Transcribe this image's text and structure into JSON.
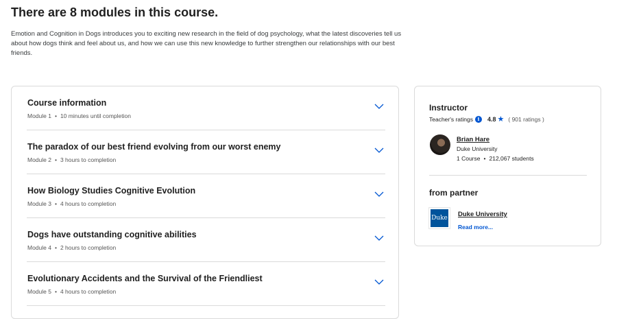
{
  "heading": "There are 8 modules in this course.",
  "description": "Emotion and Cognition in Dogs introduces you to exciting new research in the field of dog psychology, what the latest discoveries tell us about how dogs think and feel about us, and how we can use this new knowledge to further strengthen our relationships with our best friends.",
  "modules": [
    {
      "title": "Course information",
      "module": "Module 1",
      "duration": "10 minutes until completion"
    },
    {
      "title": "The paradox of our best friend evolving from our worst enemy",
      "module": "Module 2",
      "duration": "3 hours to completion"
    },
    {
      "title": "How Biology Studies Cognitive Evolution",
      "module": "Module 3",
      "duration": "4 hours to completion"
    },
    {
      "title": "Dogs have outstanding cognitive abilities",
      "module": "Module 4",
      "duration": "2 hours to completion"
    },
    {
      "title": "Evolutionary Accidents and the Survival of the Friendliest",
      "module": "Module 5",
      "duration": "4 hours to completion"
    }
  ],
  "meta_separator": "•",
  "instructor": {
    "heading": "Instructor",
    "ratings_label": "Teacher's ratings",
    "rating": "4.8",
    "rating_count": "( 901 ratings )",
    "name": "Brian Hare",
    "university": "Duke University",
    "courses": "1 Course",
    "students": "212,067 students"
  },
  "partner": {
    "heading": "from partner",
    "logo_text": "Duke",
    "name": "Duke University",
    "read_more": "Read more..."
  },
  "colors": {
    "accent": "#0056d2",
    "duke_blue": "#00539b"
  },
  "icons": {
    "chevron": "chevron-down-icon",
    "info": "info-icon",
    "star": "star-icon"
  }
}
